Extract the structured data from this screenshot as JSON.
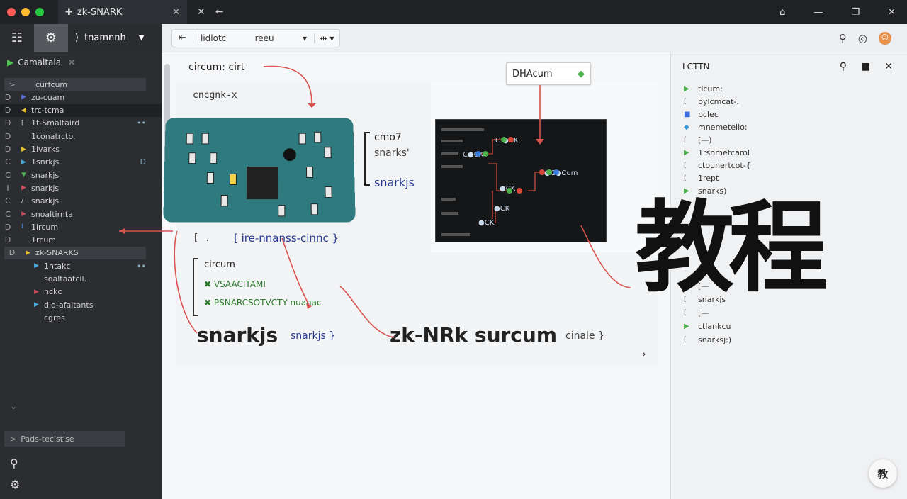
{
  "window": {
    "tab_title": "zk-SNARK",
    "tab_plus": "✚",
    "tab_close": "✕",
    "extra_close": "✕",
    "extra_back": "←",
    "controls": [
      "⌂",
      "—",
      "❐",
      "✕"
    ]
  },
  "toolbar": {
    "grid_icon": "☷",
    "gear_icon": "⚙",
    "project_caret": "⟩",
    "project_name": "tnamnnh",
    "project_chevron": "▼",
    "back": "⇤",
    "path_left": "lidlotc",
    "path_right": "reeu",
    "path_chevron": "▾",
    "action": "⇹ ▾",
    "right_icons": [
      "⚲",
      "◎"
    ],
    "avatar": "☺"
  },
  "sidebar": {
    "header": "Camaltaia",
    "items": [
      {
        "lead": ">",
        "mark": "",
        "label": "curfcum",
        "style": "box",
        "trail": ""
      },
      {
        "lead": "D",
        "mark": "▶",
        "label": "zu-cuam",
        "style": "",
        "trail": ""
      },
      {
        "lead": "D",
        "mark": "◀",
        "label": "trc-tcma",
        "style": "hl",
        "trail": ""
      },
      {
        "lead": "D",
        "mark": "[",
        "label": "1t-Smaltaird",
        "style": "",
        "trail": "••"
      },
      {
        "lead": "D",
        "mark": "",
        "label": "1conatrcto.",
        "style": "",
        "trail": ""
      },
      {
        "lead": "D",
        "mark": "▶",
        "label": "1lvarks",
        "style": "",
        "trail": ""
      },
      {
        "lead": "C",
        "mark": "▶",
        "label": "1snrkjs",
        "style": "",
        "trail": "D"
      },
      {
        "lead": "C",
        "mark": "▼",
        "label": "snarkjs",
        "style": "",
        "trail": ""
      },
      {
        "lead": "I",
        "mark": "▶",
        "label": "snarkjs",
        "style": "",
        "trail": ""
      },
      {
        "lead": "C",
        "mark": "/",
        "label": "snarkjs",
        "style": "",
        "trail": ""
      },
      {
        "lead": "C",
        "mark": "▶",
        "label": "snoaltirnta",
        "style": "",
        "trail": ""
      },
      {
        "lead": "D",
        "mark": "I",
        "label": "1lrcum",
        "style": "",
        "trail": ""
      },
      {
        "lead": "D",
        "mark": "",
        "label": "1rcum",
        "style": "",
        "trail": ""
      },
      {
        "lead": "D",
        "mark": "▶",
        "label": "zk-SNARKS",
        "style": "box",
        "trail": ""
      },
      {
        "lead": "",
        "mark": "▶",
        "label": "1ntakc",
        "style": "",
        "trail": "••"
      },
      {
        "lead": "",
        "mark": "",
        "label": "soaltaatcil.",
        "style": "",
        "trail": ""
      },
      {
        "lead": "",
        "mark": "▶",
        "label": "nckc",
        "style": "",
        "trail": ""
      },
      {
        "lead": "",
        "mark": "▶",
        "label": "dlo-afaltants",
        "style": "",
        "trail": ""
      },
      {
        "lead": "",
        "mark": "",
        "label": "cgres",
        "style": "",
        "trail": ""
      }
    ],
    "footer": "Pads-tecistise"
  },
  "editor": {
    "circuit_title": "circum: cirt",
    "left_pane_line": "cncgnk-x",
    "tag_dots": "[ .",
    "labels_right": [
      "cmo7",
      "snarks'",
      "snarkjs"
    ],
    "bracket_line": "[ ire-nnanss-cinnc }",
    "circuit_block": {
      "title": "circum",
      "lines": [
        "✖ VSAACITAMI",
        "✖ PSNARCSOTVCTY nuanac"
      ]
    },
    "big_snarkjs": "snarkjs",
    "small_snarkjs": "snarkjs }",
    "zk_title": "zk-NRk surcum",
    "zk_small": "cinale }",
    "diagram_label": "DHAcum",
    "nodes": [
      "C ●CK",
      "C●CK",
      "●CK",
      "C●C●Cum",
      "●CK",
      "●CK"
    ]
  },
  "right_panel": {
    "title": "LCTTN",
    "items": [
      {
        "mark": "▶",
        "label": "tlcum:"
      },
      {
        "mark": "[",
        "label": "bylcmcat-."
      },
      {
        "mark": "■",
        "label": "pclec"
      },
      {
        "mark": "◆",
        "label": "mnemetelio:"
      },
      {
        "mark": "[",
        "label": "[—)"
      },
      {
        "mark": "▶",
        "label": "1rsnmetcarol"
      },
      {
        "mark": "[",
        "label": "ctounertcot-{"
      },
      {
        "mark": "[",
        "label": "1rept"
      },
      {
        "mark": "▶",
        "label": "snarks)"
      },
      {
        "mark": "[",
        "label": "[—"
      },
      {
        "mark": "[",
        "label": "snarkjs"
      },
      {
        "mark": "[",
        "label": "[—"
      },
      {
        "mark": "▶",
        "label": "ctlankcu"
      },
      {
        "mark": "[",
        "label": "snarksj:)"
      }
    ],
    "kanji": "教程",
    "fab": "教"
  }
}
